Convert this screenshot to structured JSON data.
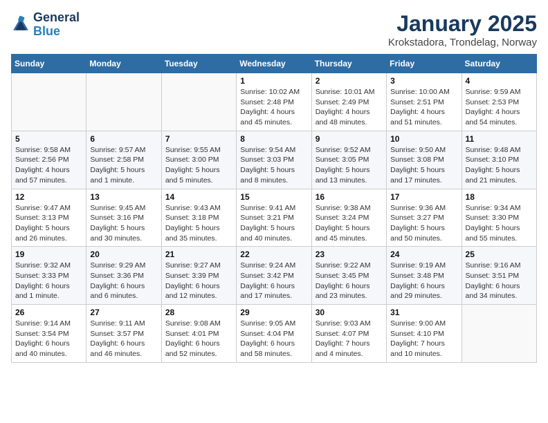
{
  "logo": {
    "line1": "General",
    "line2": "Blue"
  },
  "title": "January 2025",
  "subtitle": "Krokstadora, Trondelag, Norway",
  "weekdays": [
    "Sunday",
    "Monday",
    "Tuesday",
    "Wednesday",
    "Thursday",
    "Friday",
    "Saturday"
  ],
  "weeks": [
    [
      {
        "day": "",
        "info": ""
      },
      {
        "day": "",
        "info": ""
      },
      {
        "day": "",
        "info": ""
      },
      {
        "day": "1",
        "info": "Sunrise: 10:02 AM\nSunset: 2:48 PM\nDaylight: 4 hours and 45 minutes."
      },
      {
        "day": "2",
        "info": "Sunrise: 10:01 AM\nSunset: 2:49 PM\nDaylight: 4 hours and 48 minutes."
      },
      {
        "day": "3",
        "info": "Sunrise: 10:00 AM\nSunset: 2:51 PM\nDaylight: 4 hours and 51 minutes."
      },
      {
        "day": "4",
        "info": "Sunrise: 9:59 AM\nSunset: 2:53 PM\nDaylight: 4 hours and 54 minutes."
      }
    ],
    [
      {
        "day": "5",
        "info": "Sunrise: 9:58 AM\nSunset: 2:56 PM\nDaylight: 4 hours and 57 minutes."
      },
      {
        "day": "6",
        "info": "Sunrise: 9:57 AM\nSunset: 2:58 PM\nDaylight: 5 hours and 1 minute."
      },
      {
        "day": "7",
        "info": "Sunrise: 9:55 AM\nSunset: 3:00 PM\nDaylight: 5 hours and 5 minutes."
      },
      {
        "day": "8",
        "info": "Sunrise: 9:54 AM\nSunset: 3:03 PM\nDaylight: 5 hours and 8 minutes."
      },
      {
        "day": "9",
        "info": "Sunrise: 9:52 AM\nSunset: 3:05 PM\nDaylight: 5 hours and 13 minutes."
      },
      {
        "day": "10",
        "info": "Sunrise: 9:50 AM\nSunset: 3:08 PM\nDaylight: 5 hours and 17 minutes."
      },
      {
        "day": "11",
        "info": "Sunrise: 9:48 AM\nSunset: 3:10 PM\nDaylight: 5 hours and 21 minutes."
      }
    ],
    [
      {
        "day": "12",
        "info": "Sunrise: 9:47 AM\nSunset: 3:13 PM\nDaylight: 5 hours and 26 minutes."
      },
      {
        "day": "13",
        "info": "Sunrise: 9:45 AM\nSunset: 3:16 PM\nDaylight: 5 hours and 30 minutes."
      },
      {
        "day": "14",
        "info": "Sunrise: 9:43 AM\nSunset: 3:18 PM\nDaylight: 5 hours and 35 minutes."
      },
      {
        "day": "15",
        "info": "Sunrise: 9:41 AM\nSunset: 3:21 PM\nDaylight: 5 hours and 40 minutes."
      },
      {
        "day": "16",
        "info": "Sunrise: 9:38 AM\nSunset: 3:24 PM\nDaylight: 5 hours and 45 minutes."
      },
      {
        "day": "17",
        "info": "Sunrise: 9:36 AM\nSunset: 3:27 PM\nDaylight: 5 hours and 50 minutes."
      },
      {
        "day": "18",
        "info": "Sunrise: 9:34 AM\nSunset: 3:30 PM\nDaylight: 5 hours and 55 minutes."
      }
    ],
    [
      {
        "day": "19",
        "info": "Sunrise: 9:32 AM\nSunset: 3:33 PM\nDaylight: 6 hours and 1 minute."
      },
      {
        "day": "20",
        "info": "Sunrise: 9:29 AM\nSunset: 3:36 PM\nDaylight: 6 hours and 6 minutes."
      },
      {
        "day": "21",
        "info": "Sunrise: 9:27 AM\nSunset: 3:39 PM\nDaylight: 6 hours and 12 minutes."
      },
      {
        "day": "22",
        "info": "Sunrise: 9:24 AM\nSunset: 3:42 PM\nDaylight: 6 hours and 17 minutes."
      },
      {
        "day": "23",
        "info": "Sunrise: 9:22 AM\nSunset: 3:45 PM\nDaylight: 6 hours and 23 minutes."
      },
      {
        "day": "24",
        "info": "Sunrise: 9:19 AM\nSunset: 3:48 PM\nDaylight: 6 hours and 29 minutes."
      },
      {
        "day": "25",
        "info": "Sunrise: 9:16 AM\nSunset: 3:51 PM\nDaylight: 6 hours and 34 minutes."
      }
    ],
    [
      {
        "day": "26",
        "info": "Sunrise: 9:14 AM\nSunset: 3:54 PM\nDaylight: 6 hours and 40 minutes."
      },
      {
        "day": "27",
        "info": "Sunrise: 9:11 AM\nSunset: 3:57 PM\nDaylight: 6 hours and 46 minutes."
      },
      {
        "day": "28",
        "info": "Sunrise: 9:08 AM\nSunset: 4:01 PM\nDaylight: 6 hours and 52 minutes."
      },
      {
        "day": "29",
        "info": "Sunrise: 9:05 AM\nSunset: 4:04 PM\nDaylight: 6 hours and 58 minutes."
      },
      {
        "day": "30",
        "info": "Sunrise: 9:03 AM\nSunset: 4:07 PM\nDaylight: 7 hours and 4 minutes."
      },
      {
        "day": "31",
        "info": "Sunrise: 9:00 AM\nSunset: 4:10 PM\nDaylight: 7 hours and 10 minutes."
      },
      {
        "day": "",
        "info": ""
      }
    ]
  ]
}
